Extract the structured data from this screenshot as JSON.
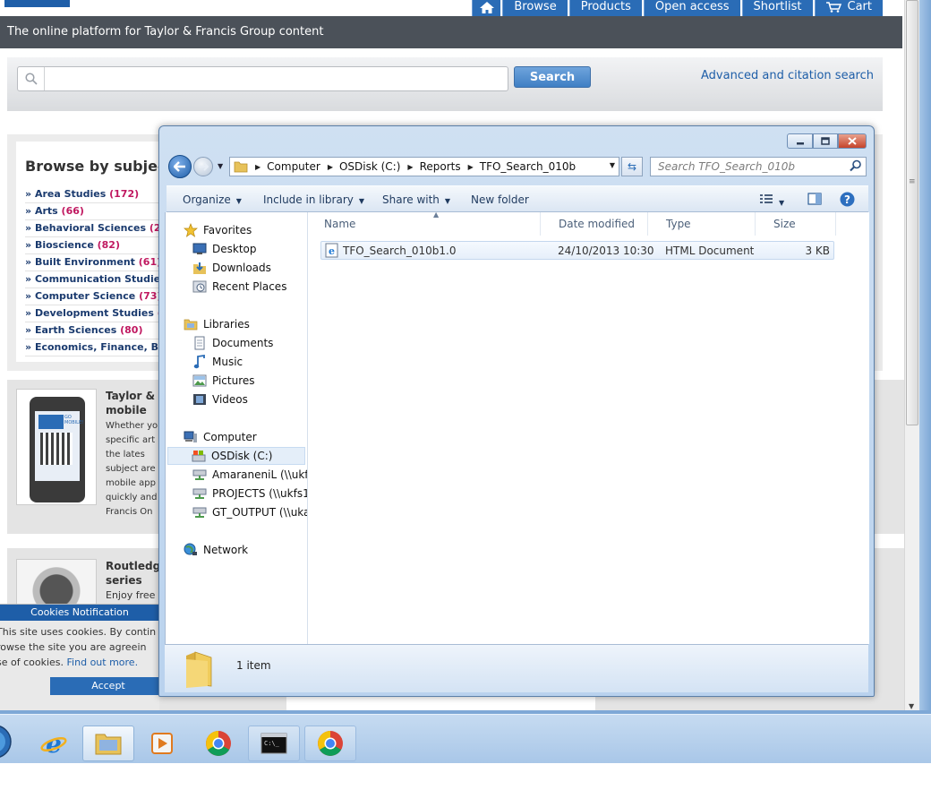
{
  "browser": {
    "nav": {
      "browse": "Browse",
      "products": "Products",
      "open_access": "Open access",
      "shortlist": "Shortlist",
      "cart": "Cart"
    },
    "tagline": "The online platform for Taylor & Francis Group content",
    "search": {
      "placeholder": "",
      "button": "Search",
      "advanced": "Advanced and citation search"
    },
    "browse": {
      "title": "Browse by subject",
      "subjects": [
        {
          "name": "Area Studies",
          "count": "(172)"
        },
        {
          "name": "Arts",
          "count": "(66)"
        },
        {
          "name": "Behavioral Sciences",
          "count": "(252"
        },
        {
          "name": "Bioscience",
          "count": "(82)"
        },
        {
          "name": "Built Environment",
          "count": "(61)"
        },
        {
          "name": "Communication Studies",
          "count": "("
        },
        {
          "name": "Computer Science",
          "count": "(73)"
        },
        {
          "name": "Development Studies",
          "count": "(7"
        },
        {
          "name": "Earth Sciences",
          "count": "(80)"
        },
        {
          "name": "Economics, Finance, Bus",
          "count": ""
        }
      ],
      "bullet": "»"
    },
    "promo_mobile": {
      "title": "Taylor & mobile",
      "text": "Whether yo specific art in the lates subject are mobile app quickly and Francis On",
      "phone_badge": "GO MOBILE!"
    },
    "promo_routledge": {
      "title": "Routledge series",
      "text": "Enjoy free"
    },
    "cookies": {
      "heading": "Cookies Notification",
      "line1": "This site uses cookies. By contin",
      "line2": "rowse the site you are agreein",
      "line3_prefix": "se of cookies.",
      "link": "Find out more.",
      "accept": "Accept"
    }
  },
  "explorer": {
    "address": [
      "Computer",
      "OSDisk (C:)",
      "Reports",
      "TFO_Search_010b"
    ],
    "search_placeholder": "Search TFO_Search_010b",
    "commands": {
      "organize": "Organize",
      "include": "Include in library",
      "share": "Share with",
      "new_folder": "New folder"
    },
    "nav_pane": {
      "favorites": "Favorites",
      "desktop": "Desktop",
      "downloads": "Downloads",
      "recent": "Recent Places",
      "libraries": "Libraries",
      "documents": "Documents",
      "music": "Music",
      "pictures": "Pictures",
      "videos": "Videos",
      "computer": "Computer",
      "osdisk": "OSDisk (C:)",
      "amaraneni": "AmaraneniL (\\\\ukfs0",
      "projects": "PROJECTS (\\\\ukfs12",
      "gt_output": "GT_OUTPUT (\\\\ukal",
      "network": "Network"
    },
    "columns": {
      "name": "Name",
      "date": "Date modified",
      "type": "Type",
      "size": "Size"
    },
    "files": [
      {
        "name": "TFO_Search_010b1.0",
        "date": "24/10/2013 10:30",
        "type": "HTML Document",
        "size": "3 KB"
      }
    ],
    "status": "1 item"
  },
  "colors": {
    "accent": "#2a6cb6",
    "count_pink": "#c01860",
    "header_dark": "#4b5159"
  }
}
